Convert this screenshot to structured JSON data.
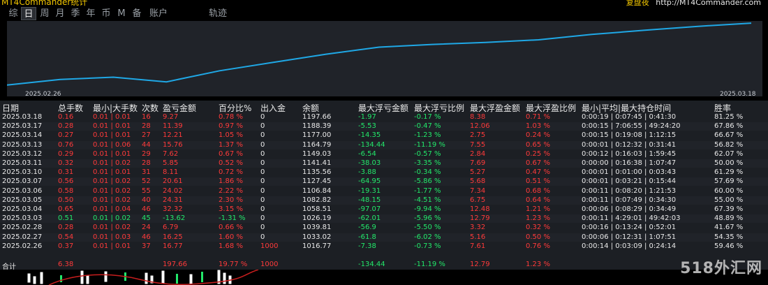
{
  "window": {
    "title": "MT4Commander统计",
    "right_label": "复盘夜",
    "right_url": "http://MT4Commander.com"
  },
  "tabs": [
    "综",
    "日",
    "周",
    "月",
    "季",
    "年",
    "币",
    "M",
    "备",
    "账户",
    "轨迹"
  ],
  "active_tab": "日",
  "chart": {
    "start_date": "2025.02.26",
    "end_date": "2025.03.18",
    "line_color": "#1fa8e6",
    "background": "#202329",
    "equity_values": [
      1016.77,
      1033.02,
      1039.81,
      1026.19,
      1058.51,
      1082.82,
      1106.84,
      1127.45,
      1135.56,
      1141.41,
      1149.03,
      1164.79,
      1177.0,
      1188.39,
      1197.66
    ]
  },
  "table": {
    "headers": [
      "日期",
      "总手数",
      "最小|大手数",
      "次数",
      "盈亏金额",
      "百分比%",
      "出入金",
      "余额",
      "最大浮亏金额",
      "最大浮亏比例",
      "最大浮盈金额",
      "最大浮盈比例",
      "最小|平均|最大持仓时间",
      "胜率"
    ],
    "rows": [
      {
        "date": "2025.03.18",
        "lots": "0.16",
        "minmax": "0.01 | 0.01",
        "count": "16",
        "pnl": "9.27",
        "pct": "0.78 %",
        "io": "0",
        "bal": "1197.66",
        "mfl": "-1.97",
        "mflp": "-0.17 %",
        "mfp": "8.38",
        "mfpp": "0.71 %",
        "time": "0:00:19 | 0:07:45 | 0:41:30",
        "win": "81.25 %",
        "color": "red"
      },
      {
        "date": "2025.03.17",
        "lots": "0.28",
        "minmax": "0.01 | 0.01",
        "count": "28",
        "pnl": "11.39",
        "pct": "0.97 %",
        "io": "0",
        "bal": "1188.39",
        "mfl": "-5.53",
        "mflp": "-0.47 %",
        "mfp": "12.06",
        "mfpp": "1.03 %",
        "time": "0:00:15 | 7:06:55 | 49:24:20",
        "win": "67.86 %",
        "color": "red"
      },
      {
        "date": "2025.03.14",
        "lots": "0.27",
        "minmax": "0.01 | 0.01",
        "count": "27",
        "pnl": "12.21",
        "pct": "1.05 %",
        "io": "0",
        "bal": "1177.00",
        "mfl": "-14.35",
        "mflp": "-1.23 %",
        "mfp": "2.75",
        "mfpp": "0.24 %",
        "time": "0:00:15 | 0:19:08 | 1:12:15",
        "win": "66.67 %",
        "color": "red"
      },
      {
        "date": "2025.03.13",
        "lots": "0.76",
        "minmax": "0.01 | 0.06",
        "count": "44",
        "pnl": "15.76",
        "pct": "1.37 %",
        "io": "0",
        "bal": "1164.79",
        "mfl": "-134.44",
        "mflp": "-11.19 %",
        "mfp": "7.55",
        "mfpp": "0.65 %",
        "time": "0:00:01 | 0:12:32 | 0:31:41",
        "win": "56.82 %",
        "color": "red"
      },
      {
        "date": "2025.03.12",
        "lots": "0.29",
        "minmax": "0.01 | 0.01",
        "count": "29",
        "pnl": "7.62",
        "pct": "0.67 %",
        "io": "0",
        "bal": "1149.03",
        "mfl": "-6.54",
        "mflp": "-0.57 %",
        "mfp": "2.84",
        "mfpp": "0.25 %",
        "time": "0:00:12 | 0:16:03 | 1:59:45",
        "win": "62.07 %",
        "color": "red"
      },
      {
        "date": "2025.03.11",
        "lots": "0.32",
        "minmax": "0.01 | 0.02",
        "count": "28",
        "pnl": "5.85",
        "pct": "0.52 %",
        "io": "0",
        "bal": "1141.41",
        "mfl": "-38.03",
        "mflp": "-3.35 %",
        "mfp": "7.69",
        "mfpp": "0.67 %",
        "time": "0:00:00 | 0:16:38 | 1:07:47",
        "win": "50.00 %",
        "color": "red"
      },
      {
        "date": "2025.03.10",
        "lots": "0.31",
        "minmax": "0.01 | 0.01",
        "count": "31",
        "pnl": "8.11",
        "pct": "0.72 %",
        "io": "0",
        "bal": "1135.56",
        "mfl": "-3.88",
        "mflp": "-0.34 %",
        "mfp": "5.27",
        "mfpp": "0.47 %",
        "time": "0:00:01 | 0:01:00 | 0:03:43",
        "win": "61.29 %",
        "color": "red"
      },
      {
        "date": "2025.03.07",
        "lots": "0.56",
        "minmax": "0.01 | 0.02",
        "count": "52",
        "pnl": "20.61",
        "pct": "1.86 %",
        "io": "0",
        "bal": "1127.45",
        "mfl": "-64.95",
        "mflp": "-5.86 %",
        "mfp": "5.68",
        "mfpp": "0.51 %",
        "time": "0:00:01 | 0:03:21 | 0:15:44",
        "win": "57.69 %",
        "color": "red"
      },
      {
        "date": "2025.03.06",
        "lots": "0.58",
        "minmax": "0.01 | 0.02",
        "count": "55",
        "pnl": "24.02",
        "pct": "2.22 %",
        "io": "0",
        "bal": "1106.84",
        "mfl": "-19.31",
        "mflp": "-1.77 %",
        "mfp": "7.34",
        "mfpp": "0.68 %",
        "time": "0:00:11 | 0:08:20 | 1:21:53",
        "win": "60.00 %",
        "color": "red"
      },
      {
        "date": "2025.03.05",
        "lots": "0.50",
        "minmax": "0.01 | 0.02",
        "count": "40",
        "pnl": "24.31",
        "pct": "2.30 %",
        "io": "0",
        "bal": "1082.82",
        "mfl": "-48.15",
        "mflp": "-4.51 %",
        "mfp": "6.75",
        "mfpp": "0.64 %",
        "time": "0:00:11 | 0:07:49 | 0:34:30",
        "win": "55.00 %",
        "color": "red"
      },
      {
        "date": "2025.03.04",
        "lots": "0.65",
        "minmax": "0.01 | 0.04",
        "count": "46",
        "pnl": "32.32",
        "pct": "3.15 %",
        "io": "0",
        "bal": "1058.51",
        "mfl": "-97.07",
        "mflp": "-9.94 %",
        "mfp": "12.48",
        "mfpp": "1.21 %",
        "time": "0:00:06 | 0:08:29 | 0:34:49",
        "win": "67.39 %",
        "color": "red"
      },
      {
        "date": "2025.03.03",
        "lots": "0.51",
        "minmax": "0.01 | 0.02",
        "count": "45",
        "pnl": "-13.62",
        "pct": "-1.31 %",
        "io": "0",
        "bal": "1026.19",
        "mfl": "-62.01",
        "mflp": "-5.96 %",
        "mfp": "12.79",
        "mfpp": "1.23 %",
        "time": "0:00:11 | 4:29:01 | 49:42:03",
        "win": "48.89 %",
        "color": "grn"
      },
      {
        "date": "2025.02.28",
        "lots": "0.28",
        "minmax": "0.01 | 0.02",
        "count": "24",
        "pnl": "6.79",
        "pct": "0.66 %",
        "io": "0",
        "bal": "1039.81",
        "mfl": "-56.9",
        "mflp": "-5.50 %",
        "mfp": "3.32",
        "mfpp": "0.32 %",
        "time": "0:00:16 | 0:13:24 | 0:52:01",
        "win": "41.67 %",
        "color": "red"
      },
      {
        "date": "2025.02.27",
        "lots": "0.54",
        "minmax": "0.01 | 0.03",
        "count": "46",
        "pnl": "16.25",
        "pct": "1.60 %",
        "io": "0",
        "bal": "1033.02",
        "mfl": "-61.8",
        "mflp": "-6.02 %",
        "mfp": "5.16",
        "mfpp": "0.50 %",
        "time": "0:00:06 | 0:12:31 | 1:07:51",
        "win": "54.35 %",
        "color": "red"
      },
      {
        "date": "2025.02.26",
        "lots": "0.37",
        "minmax": "0.01 | 0.01",
        "count": "37",
        "pnl": "16.77",
        "pct": "1.68 %",
        "io": "1000",
        "bal": "1016.77",
        "mfl": "-7.38",
        "mflp": "-0.73 %",
        "mfp": "7.61",
        "mfpp": "0.76 %",
        "time": "0:00:14 | 0:03:09 | 0:24:14",
        "win": "59.46 %",
        "color": "red"
      }
    ],
    "total": {
      "label": "合计",
      "lots": "6.38",
      "pnl": "197.66",
      "pct": "19.77 %",
      "io": "1000",
      "mfl": "-134.44",
      "mflp": "-11.19 %",
      "mfp": "12.79",
      "mfpp": "1.23 %"
    }
  },
  "watermark": "518外汇网"
}
